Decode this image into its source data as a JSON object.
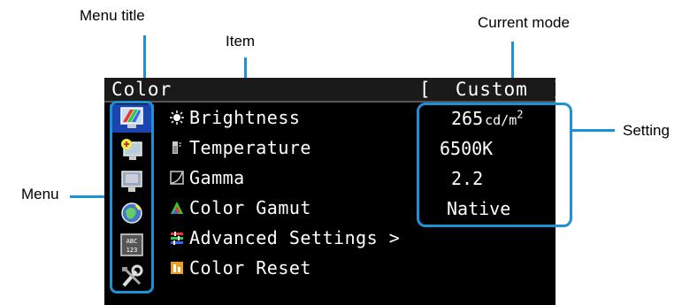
{
  "callouts": {
    "menu_title": "Menu title",
    "item": "Item",
    "current_mode": "Current mode",
    "setting": "Setting",
    "menu": "Menu"
  },
  "osd": {
    "title": "Color",
    "mode": "[  Custom  ]",
    "menu_icons": [
      "color-icon",
      "signal-icon",
      "monitor-settings-icon",
      "language-icon",
      "information-icon",
      "tools-icon"
    ],
    "items": [
      {
        "label": "Brightness",
        "icon": "sun-icon"
      },
      {
        "label": "Temperature",
        "icon": "thermometer-icon"
      },
      {
        "label": "Gamma",
        "icon": "gamma-icon"
      },
      {
        "label": "Color Gamut",
        "icon": "color-triangle-icon"
      },
      {
        "label": "Advanced Settings >",
        "icon": "sliders-icon"
      },
      {
        "label": "Color Reset",
        "icon": "reset-icon"
      }
    ],
    "settings": {
      "brightness_value": "265",
      "brightness_unit": "cd/m",
      "brightness_sup": "2",
      "temperature": "6500K",
      "gamma": "2.2",
      "gamut": "Native"
    }
  },
  "colors": {
    "accent": "#1e90d6",
    "osd_bg": "#000000",
    "highlight": "#1a45b0"
  }
}
